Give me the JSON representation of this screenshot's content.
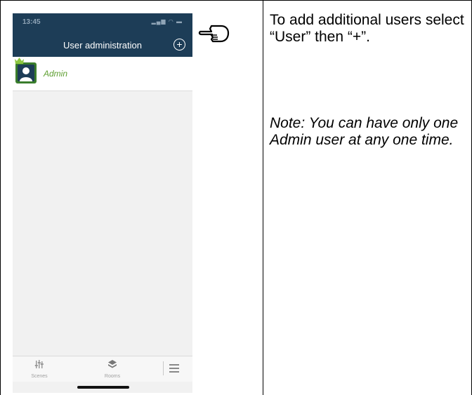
{
  "phone": {
    "status_time": "13:45",
    "status_icons": "▂▄▆ ◠ ▬",
    "header_title": "User administration",
    "add_symbol": "+",
    "users": [
      {
        "name": "Admin",
        "role_icon": "crown-icon"
      }
    ],
    "tabbar": {
      "scenes_label": "Scenes",
      "rooms_label": "Rooms"
    }
  },
  "instruction_text": "To add additional users select “User” then “+”.",
  "note_text": "Note: You can have only one Admin user at any one time.",
  "colors": {
    "header_bg": "#1d3d57",
    "accent_green": "#5c9e2e",
    "content_bg": "#f1f1f1"
  }
}
